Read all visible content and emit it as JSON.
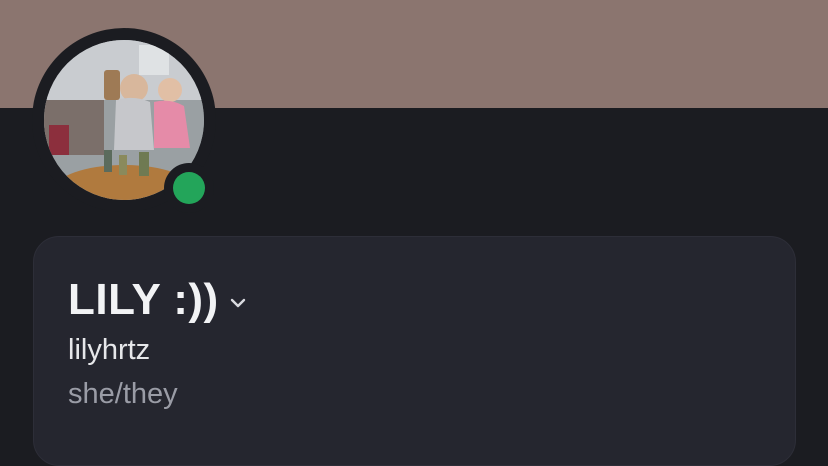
{
  "profile": {
    "display_name": "LILY :))",
    "username": "lilyhrtz",
    "pronouns": "she/they",
    "status": "online"
  },
  "colors": {
    "banner": "#8b756f",
    "status_online": "#23a55a",
    "card_bg": "#25262f",
    "page_bg": "#1b1c21"
  },
  "icons": {
    "name_expand": "chevron-down-icon",
    "status": "online-status-dot"
  }
}
